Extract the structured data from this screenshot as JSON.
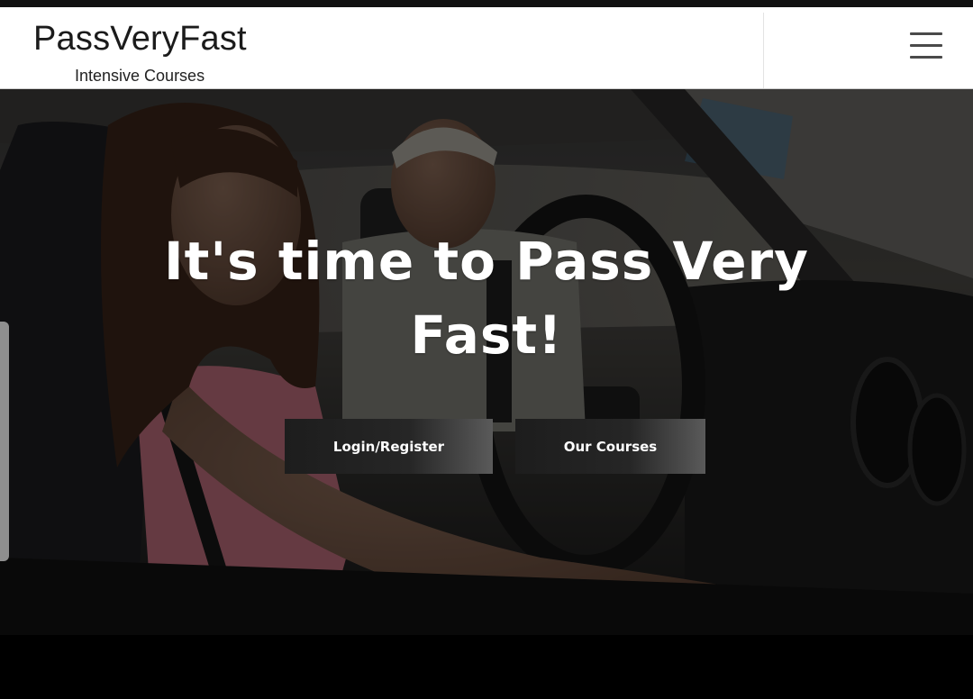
{
  "header": {
    "brand": "PassVeryFast",
    "tagline": "Intensive Courses",
    "menu_icon": "hamburger-menu-icon"
  },
  "hero": {
    "title": "It's time to Pass Very Fast!",
    "buttons": {
      "login_register": "Login/Register",
      "our_courses": "Our Courses"
    }
  },
  "colors": {
    "header_bg": "#ffffff",
    "hero_overlay": "#000000",
    "button_bg": "#1d1d1d",
    "text_light": "#ffffff"
  }
}
